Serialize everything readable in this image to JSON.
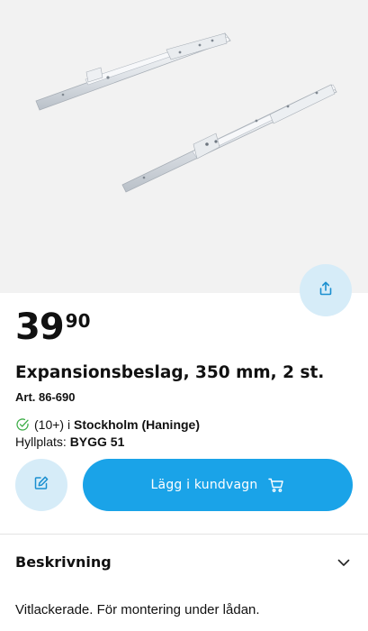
{
  "product": {
    "image_alt": "Expansionsbeslag",
    "price_int": "39",
    "price_dec": "90",
    "title": "Expansionsbeslag, 350 mm, 2 st.",
    "art_no": "Art. 86-690"
  },
  "stock": {
    "count": "(10+)",
    "prefix": "i",
    "store": "Stockholm (Haninge)",
    "status_color": "#3fae49"
  },
  "shelf": {
    "label": "Hyllplats:",
    "value": "BYGG 51"
  },
  "actions": {
    "add_to_cart": "Lägg i kundvagn",
    "accent": "#1aa3e8",
    "soft_accent": "#d6ecf8"
  },
  "icons": {
    "share": "share-icon",
    "note": "edit-note-icon",
    "cart": "cart-icon",
    "check": "check-circle-icon",
    "chevron": "chevron-down-icon"
  },
  "description": {
    "heading": "Beskrivning",
    "text": "Vitlackerade. För montering under lådan."
  }
}
